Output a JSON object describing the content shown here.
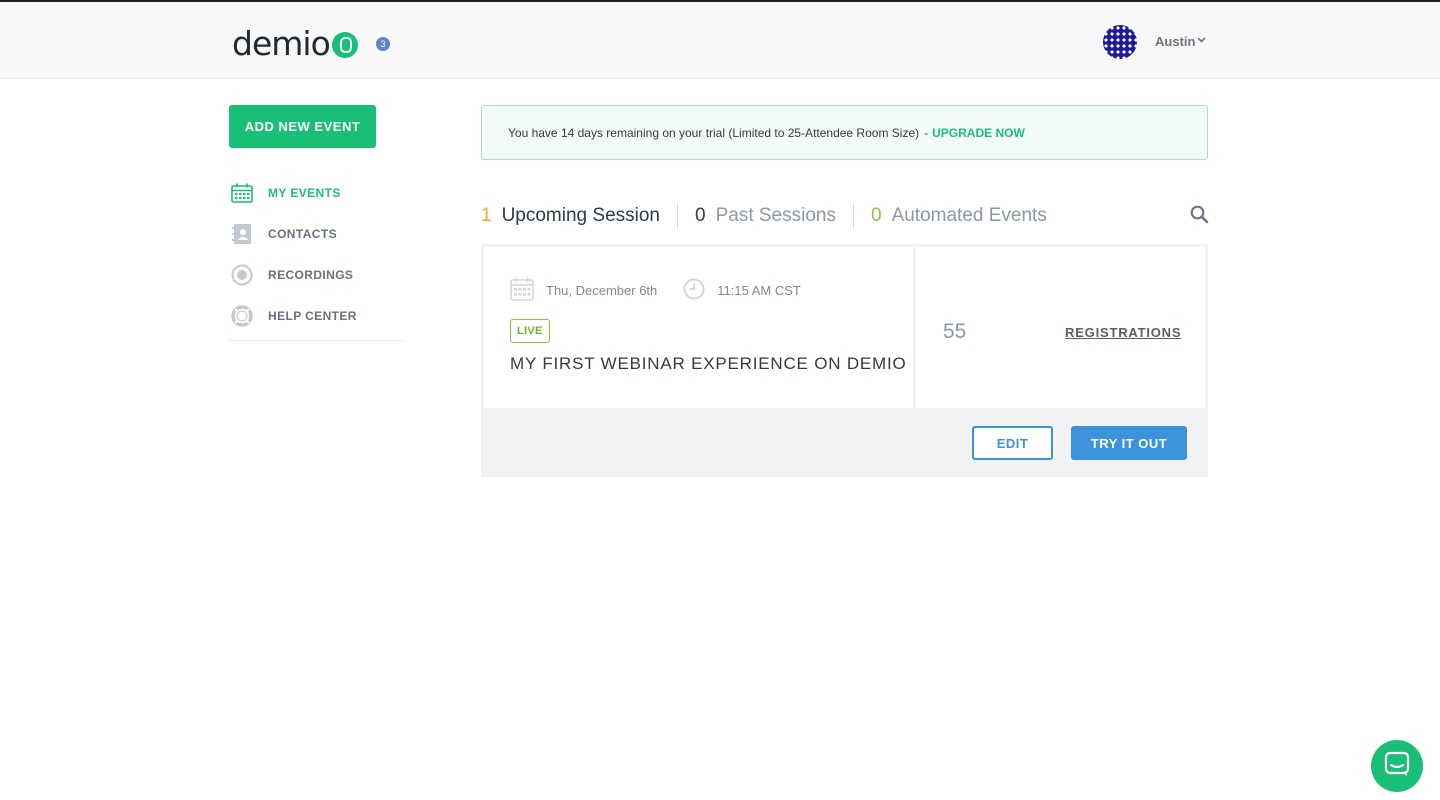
{
  "header": {
    "logo_text": "demio",
    "notification_count": "3",
    "user_name": "Austin",
    "icons": {
      "avatar": "avatar",
      "chevron": "chevron-down-icon"
    }
  },
  "sidebar": {
    "add_event_label": "ADD NEW EVENT",
    "items": [
      {
        "label": "MY EVENTS",
        "icon": "calendar-icon",
        "active": true
      },
      {
        "label": "CONTACTS",
        "icon": "contacts-icon",
        "active": false
      },
      {
        "label": "RECORDINGS",
        "icon": "recordings-icon",
        "active": false
      },
      {
        "label": "HELP CENTER",
        "icon": "lifebuoy-icon",
        "active": false
      }
    ]
  },
  "banner": {
    "text": "You have 14 days remaining on your trial (Limited to 25-Attendee Room Size)",
    "separator": "-",
    "link": "UPGRADE NOW"
  },
  "tabs": [
    {
      "count": "1",
      "label": "Upcoming Session"
    },
    {
      "count": "0",
      "label": "Past Sessions"
    },
    {
      "count": "0",
      "label": "Automated Events"
    }
  ],
  "event": {
    "date": "Thu, December 6th",
    "time": "11:15 AM CST",
    "status": "LIVE",
    "title": "MY FIRST WEBINAR EXPERIENCE ON DEMIO",
    "registrations_count": "55",
    "registrations_label": "REGISTRATIONS",
    "edit_label": "EDIT",
    "try_label": "TRY IT OUT"
  },
  "colors": {
    "brand_green": "#19bf76",
    "blue": "#3a93db",
    "orange": "#f5a623",
    "lime": "#8ec63f"
  }
}
